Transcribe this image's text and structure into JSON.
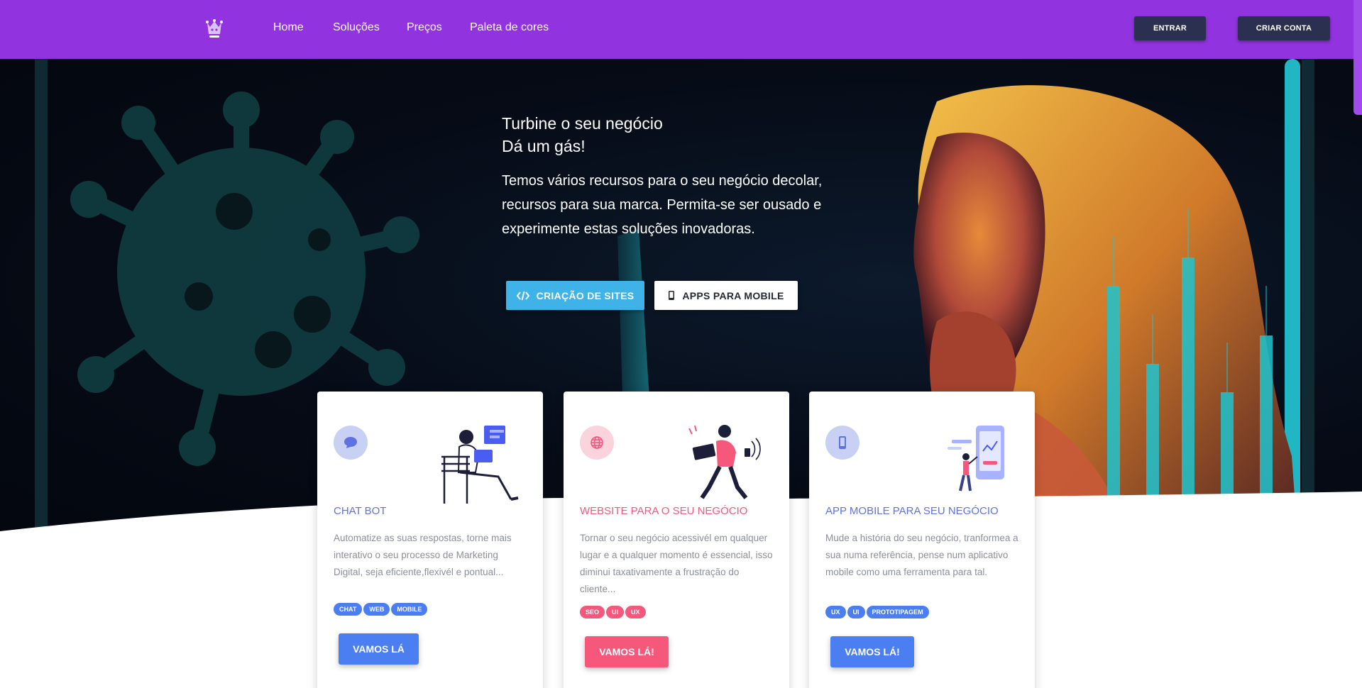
{
  "nav": {
    "logo": "crown-logo",
    "links": [
      "Home",
      "Soluções",
      "Preços",
      "Paleta de cores"
    ],
    "login": "ENTRAR",
    "signup": "CRIAR CONTA"
  },
  "hero": {
    "title": "Turbine o seu negócio",
    "subtitle": "Dá um gás!",
    "text": "Temos vários recursos para o seu negócio decolar, recursos para sua marca. Permita-se ser ousado e experimente estas soluções inovadoras.",
    "btn_sites": "CRIAÇÃO DE SITES",
    "btn_mobile": "APPS PARA MOBILE"
  },
  "cards": [
    {
      "title": "CHAT BOT",
      "text": "Automatize as suas respostas, torne mais interativo o seu processo de Marketing Digital, seja eficiente,flexivél e pontual...",
      "tags": [
        "CHAT",
        "WEB",
        "MOBILE"
      ],
      "button": "VAMOS LÁ",
      "icon": "chat-bubble-icon",
      "color": "#5e72e4"
    },
    {
      "title": "WEBSITE PARA O SEU NEGÓCIO",
      "text": "Tornar o seu negócio acessivél em qualquer lugar e a qualquer momento é essencial, isso diminui taxativamente a frustração do cliente...",
      "tags": [
        "SEO",
        "UI",
        "UX"
      ],
      "button": "VAMOS LÁ!",
      "icon": "globe-icon",
      "color": "#f5587b"
    },
    {
      "title": "APP MOBILE PARA SEU NEGÓCIO",
      "text": "Mude a história do seu negócio, tranformea a sua numa referência, pense num aplicativo mobile como uma ferramenta para tal.",
      "tags": [
        "UX",
        "UI",
        "PROTOTIPAGEM"
      ],
      "button": "VAMOS LÁ!",
      "icon": "smartphone-icon",
      "color": "#5e72e4"
    }
  ],
  "colors": {
    "nav_bg": "#9233e0",
    "nav_button": "#2c3050",
    "primary_blue": "#4b7ef0",
    "accent_pink": "#f5587b",
    "cyan": "#3fb2e8"
  }
}
